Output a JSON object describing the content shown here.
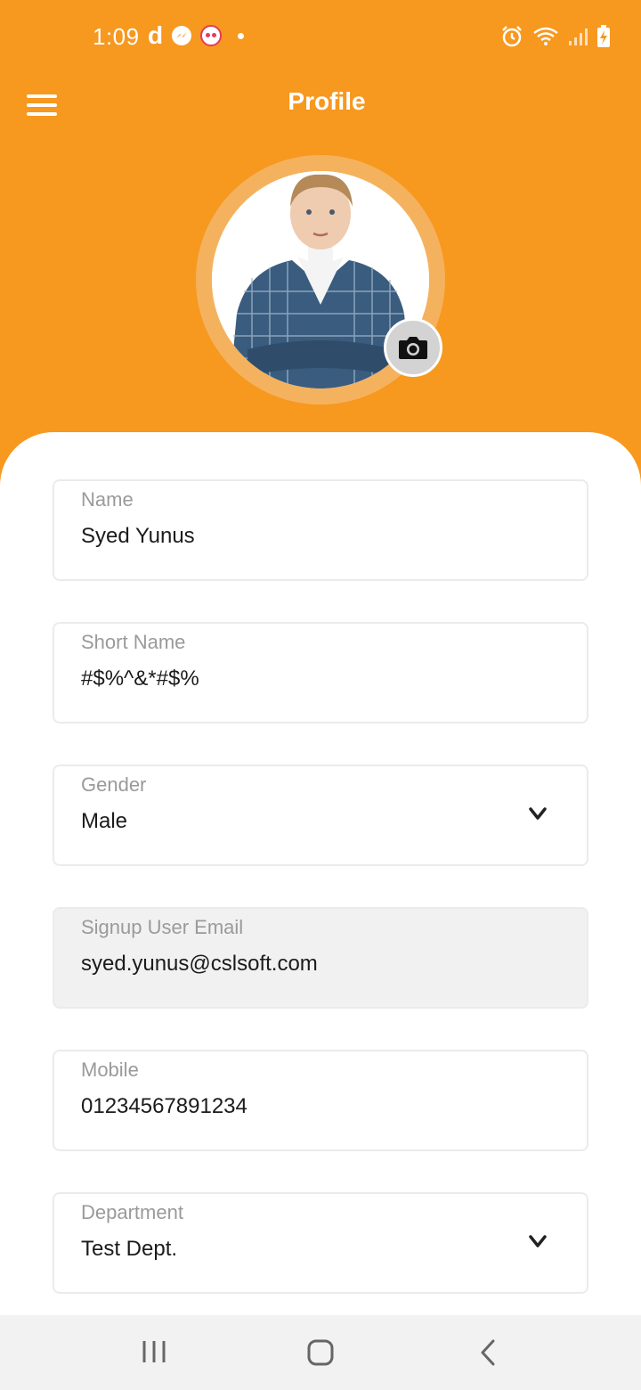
{
  "status_bar": {
    "time": "1:09",
    "left_icons": [
      "d-app-icon",
      "messenger-icon",
      "foodpanda-icon",
      "notification-dot"
    ],
    "right_icons": [
      "alarm-icon",
      "wifi-icon",
      "signal-icon",
      "battery-charging-icon"
    ]
  },
  "header": {
    "title": "Profile",
    "menu_icon": "hamburger-menu-icon"
  },
  "avatar": {
    "image": "profile-photo-boy",
    "camera_icon": "camera-icon"
  },
  "form": {
    "fields": [
      {
        "label": "Name",
        "value": "Syed Yunus"
      },
      {
        "label": "Short Name",
        "value": "#$%^&*#$%"
      },
      {
        "label": "Gender",
        "value": "Male"
      },
      {
        "label": "Signup User Email",
        "value": "syed.yunus@cslsoft.com"
      },
      {
        "label": "Mobile",
        "value": "01234567891234"
      },
      {
        "label": "Department",
        "value": "Test Dept."
      }
    ]
  },
  "nav_bar": {
    "icons": [
      "recent-apps-icon",
      "home-icon",
      "back-icon"
    ]
  },
  "colors": {
    "brand": "#F7981F",
    "ring": "#F5B25E",
    "disabled_field": "#F1F1F1",
    "label": "#9A9A9A"
  }
}
